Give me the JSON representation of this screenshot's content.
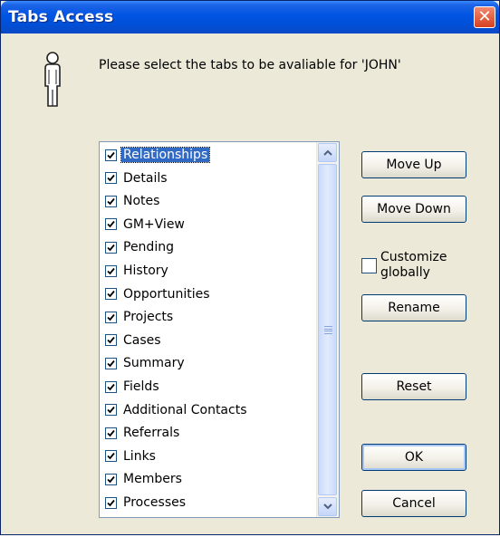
{
  "window": {
    "title": "Tabs Access"
  },
  "prompt": "Please select the tabs to be avaliable for 'JOHN'",
  "tabs": [
    {
      "label": "Relationships",
      "checked": true,
      "selected": true
    },
    {
      "label": "Details",
      "checked": true
    },
    {
      "label": "Notes",
      "checked": true
    },
    {
      "label": "GM+View",
      "checked": true
    },
    {
      "label": "Pending",
      "checked": true
    },
    {
      "label": "History",
      "checked": true
    },
    {
      "label": "Opportunities",
      "checked": true
    },
    {
      "label": "Projects",
      "checked": true
    },
    {
      "label": "Cases",
      "checked": true
    },
    {
      "label": "Summary",
      "checked": true
    },
    {
      "label": "Fields",
      "checked": true
    },
    {
      "label": "Additional Contacts",
      "checked": true
    },
    {
      "label": "Referrals",
      "checked": true
    },
    {
      "label": "Links",
      "checked": true
    },
    {
      "label": "Members",
      "checked": true
    },
    {
      "label": "Processes",
      "checked": true
    }
  ],
  "buttons": {
    "move_up": "Move Up",
    "move_down": "Move Down",
    "customize_label": "Customize globally",
    "rename": "Rename",
    "reset": "Reset",
    "ok": "OK",
    "cancel": "Cancel"
  },
  "icons": {
    "close": "close-icon",
    "user": "user-icon",
    "scroll_up": "chevron-up-icon",
    "scroll_down": "chevron-down-icon"
  },
  "colors": {
    "title_bar": "#0054e3",
    "selection": "#316ac5",
    "dialog_bg": "#ece9d8",
    "close_button": "#d6401f"
  }
}
